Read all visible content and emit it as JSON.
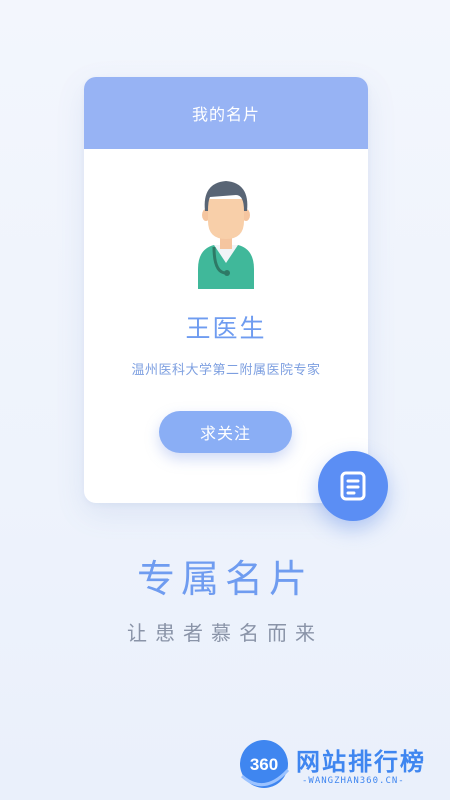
{
  "card": {
    "title": "我的名片",
    "doctor_name": "王医生",
    "hospital": "温州医科大学第二附属医院专家",
    "follow_label": "求关注"
  },
  "fab": {
    "icon": "document-icon"
  },
  "headline": "专属名片",
  "subline": "让患者慕名而来",
  "watermark": {
    "logo_text": "360",
    "name": "网站排行榜",
    "domain": "-WANGZHAN360.CN-"
  },
  "colors": {
    "header": "#97b3f4",
    "accent": "#6f9cf0",
    "button": "#8aaef5",
    "fab": "#5b8ef4",
    "watermark": "#3f86f0"
  }
}
